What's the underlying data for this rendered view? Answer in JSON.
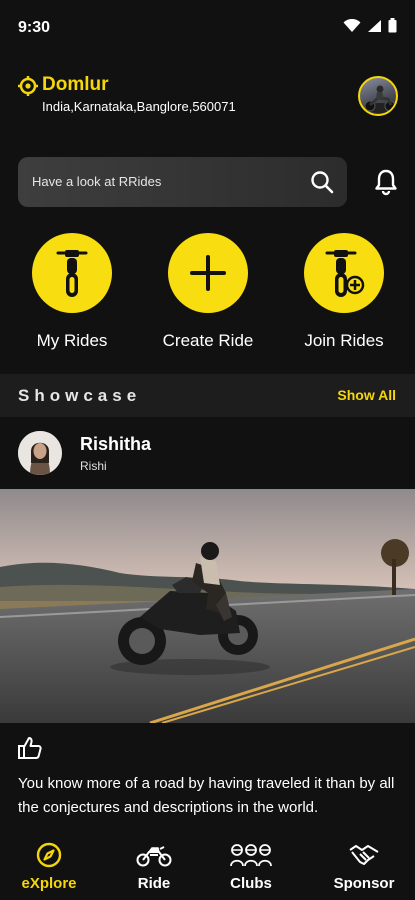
{
  "status_bar": {
    "time": "9:30"
  },
  "location": {
    "name": "Domlur",
    "address": "India,Karnataka,Banglore,560071"
  },
  "search": {
    "placeholder": "Have a look at RRides"
  },
  "actions": [
    {
      "label": "My Rides"
    },
    {
      "label": "Create Ride"
    },
    {
      "label": "Join Rides"
    }
  ],
  "showcase": {
    "title": "Showcase",
    "show_all_label": "Show All"
  },
  "post": {
    "author_name": "Rishitha",
    "author_handle": "Rishi",
    "caption": "You know more of a road by having traveled it than by all the conjectures and descriptions in the world."
  },
  "bottom_nav": {
    "items": [
      {
        "label": "eXplore",
        "active": true
      },
      {
        "label": "Ride",
        "active": false
      },
      {
        "label": "Clubs",
        "active": false
      },
      {
        "label": "Sponsor",
        "active": false
      }
    ]
  },
  "colors": {
    "accent": "#f5d60b",
    "background": "#111111",
    "panel": "#1d1d1d"
  }
}
